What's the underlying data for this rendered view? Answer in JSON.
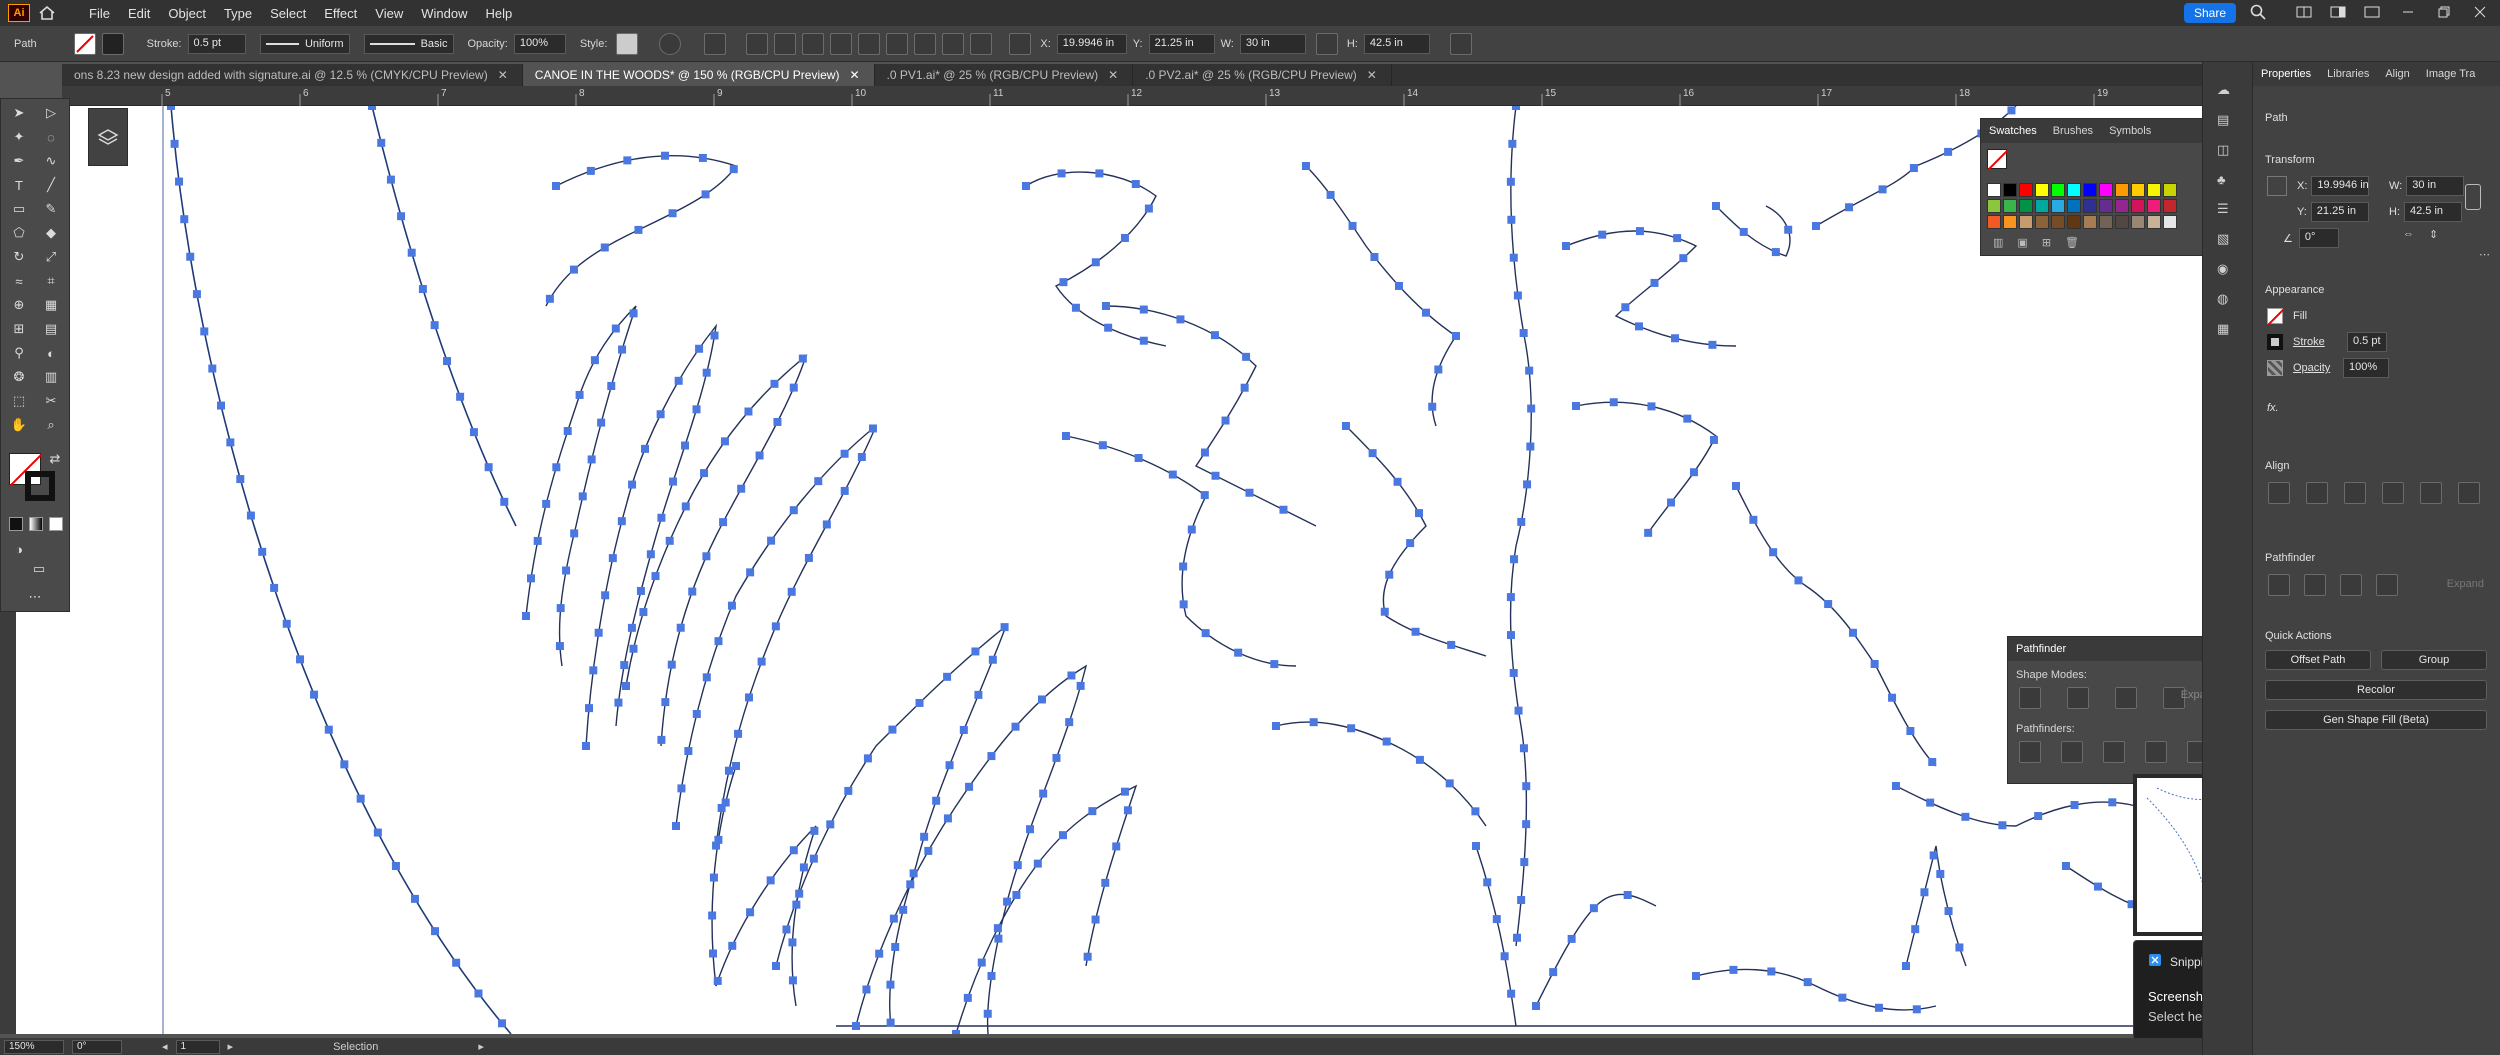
{
  "app": {
    "logo": "Ai",
    "menu": [
      "File",
      "Edit",
      "Object",
      "Type",
      "Select",
      "Effect",
      "View",
      "Window",
      "Help"
    ],
    "share_label": "Share"
  },
  "control_bar": {
    "selection_type": "Path",
    "stroke_label": "Stroke:",
    "stroke_weight": "0.5 pt",
    "stroke_profile": "Uniform",
    "brush": "Basic",
    "opacity_label": "Opacity:",
    "opacity_value": "100%",
    "style_label": "Style:",
    "x_label": "X:",
    "x_value": "19.9946 in",
    "y_label": "Y:",
    "y_value": "21.25 in",
    "w_label": "W:",
    "w_value": "30 in",
    "h_label": "H:",
    "h_value": "42.5 in"
  },
  "doc_tabs": [
    {
      "label": "ons 8.23 new design added with signature.ai @ 12.5 % (CMYK/CPU Preview)",
      "active": false
    },
    {
      "label": "CANOE IN THE WOODS* @ 150 % (RGB/CPU Preview)",
      "active": true
    },
    {
      "label": ".0 PV1.ai* @ 25 % (RGB/CPU Preview)",
      "active": false
    },
    {
      "label": ".0 PV2.ai* @ 25 % (RGB/CPU Preview)",
      "active": false
    }
  ],
  "ruler_numbers": [
    "5",
    "6",
    "7",
    "8",
    "9",
    "10",
    "11",
    "12",
    "13",
    "14",
    "15",
    "16",
    "17",
    "18",
    "19"
  ],
  "swatches_panel": {
    "tabs": [
      "Swatches",
      "Brushes",
      "Symbols"
    ],
    "colors": [
      "#ffffff",
      "#000000",
      "#ff0000",
      "#ffff00",
      "#00ff00",
      "#00ffff",
      "#0000ff",
      "#ff00ff",
      "#ff9900",
      "#ffcc00",
      "#f5f500",
      "#c8d400",
      "#8cc63f",
      "#39b54a",
      "#009245",
      "#00a99d",
      "#29abe2",
      "#0071bc",
      "#2e3192",
      "#662d91",
      "#93278f",
      "#d4145a",
      "#ed1e79",
      "#c1272d",
      "#f15a24",
      "#f7931e",
      "#c69c6d",
      "#8c6239",
      "#754c24",
      "#603813",
      "#a67c52",
      "#736357",
      "#534741",
      "#998675",
      "#c7b299",
      "#e6e6e6"
    ]
  },
  "pathfinder_panel": {
    "title": "Pathfinder",
    "shape_modes_label": "Shape Modes:",
    "expand_label": "Expand",
    "pathfinders_label": "Pathfinders:"
  },
  "properties": {
    "tabs": [
      "Properties",
      "Libraries",
      "Align",
      "Image Tra"
    ],
    "object_type": "Path",
    "transform_label": "Transform",
    "x_label": "X:",
    "x_value": "19.9946 in",
    "y_label": "Y:",
    "y_value": "21.25 in",
    "w_label": "W:",
    "w_value": "30 in",
    "h_label": "H:",
    "h_value": "42.5 in",
    "angle_value": "0°",
    "appearance_label": "Appearance",
    "fill_label": "Fill",
    "stroke_label": "Stroke",
    "stroke_value": "0.5 pt",
    "opacity_label": "Opacity",
    "opacity_value": "100%",
    "fx_label": "fx.",
    "align_label": "Align",
    "pathfinder_label": "Pathfinder",
    "expand_label": "Expand",
    "quick_actions_label": "Quick Actions",
    "offset_path_label": "Offset Path",
    "group_label": "Group",
    "recolor_label": "Recolor",
    "gen_shape_fill_label": "Gen Shape Fill (Beta)"
  },
  "status_bar": {
    "zoom": "150%",
    "rotation": "0°",
    "artboard": "1",
    "tool": "Selection"
  },
  "toast": {
    "app_name": "Snipping Tool",
    "title": "Screenshot copied to clipboard and saved",
    "body": "Select here to mark up and share."
  },
  "icons": [
    "home-icon",
    "search-icon",
    "arrange-icon",
    "minimize-icon",
    "restore-icon",
    "close-icon"
  ]
}
